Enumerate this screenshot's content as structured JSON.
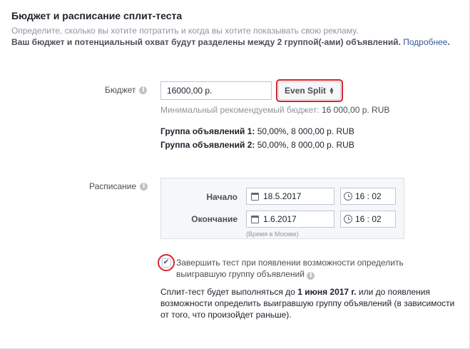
{
  "header": {
    "title": "Бюджет и расписание сплит-теста",
    "subtitle": "Определите, сколько вы хотите потратить и когда вы хотите показывать свою рекламу.",
    "note": "Ваш бюджет и потенциальный охват будут разделены между 2 группой(-ами) объявлений.",
    "more_link": "Подробнее",
    "more_suffix": "."
  },
  "budget": {
    "label": "Бюджет",
    "value": "16000,00 р.",
    "split_label": "Even Split",
    "min_prefix": "Минимальный рекомендуемый бюджет:",
    "min_value": "16 000,00 р. RUB"
  },
  "groups": [
    {
      "name": "Группа объявлений 1:",
      "value": "50,00%, 8 000,00 р. RUB"
    },
    {
      "name": "Группа объявлений 2:",
      "value": "50,00%, 8 000,00 р. RUB"
    }
  ],
  "schedule": {
    "label": "Расписание",
    "start_label": "Начало",
    "start_date": "18.5.2017",
    "start_time": "16 : 02",
    "end_label": "Окончание",
    "end_date": "1.6.2017",
    "end_time": "16 : 02",
    "tz_note": "(Время в Москве)"
  },
  "end_test": {
    "checked": true,
    "label": "Завершить тест при появлении возможности определить выигравшую группу объявлений"
  },
  "description": {
    "prefix": "Сплит-тест будет выполняться до",
    "date": "1 июня 2017 г.",
    "suffix": "или до появления возможности определить выигравшую группу объявлений (в зависимости от того, что произойдет раньше)."
  },
  "colors": {
    "highlight": "#d9232d",
    "link": "#365899"
  }
}
